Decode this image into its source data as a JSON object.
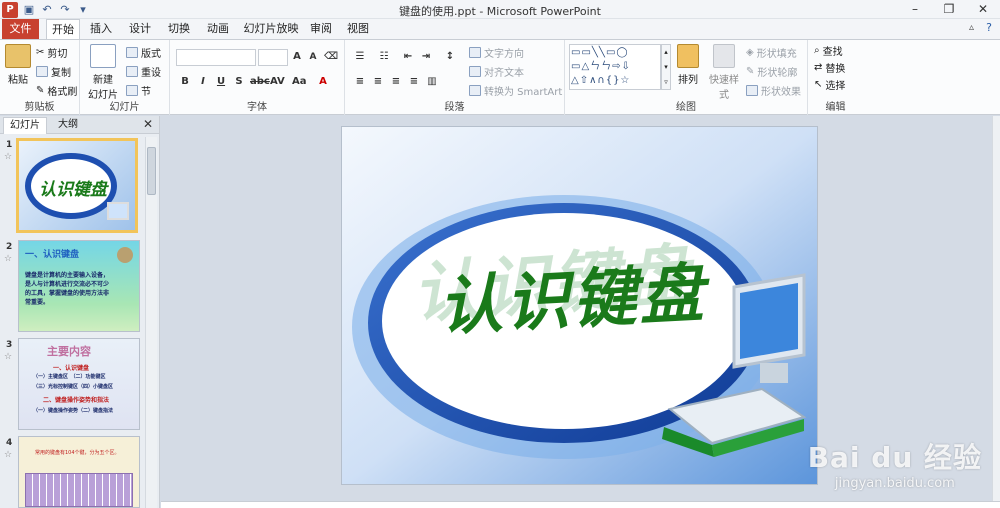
{
  "window": {
    "title": "键盘的使用.ppt - Microsoft PowerPoint"
  },
  "tabs": [
    "文件",
    "开始",
    "插入",
    "设计",
    "切换",
    "动画",
    "幻灯片放映",
    "审阅",
    "视图"
  ],
  "ribbon": {
    "clipboard": {
      "paste": "粘贴",
      "cut": "剪切",
      "copy": "复制",
      "format_painter": "格式刷",
      "label": "剪贴板"
    },
    "slides": {
      "new_slide": "新建",
      "new_slide2": "幻灯片",
      "layout": "版式",
      "reset": "重设",
      "section": "节",
      "label": "幻灯片"
    },
    "font": {
      "label": "字体"
    },
    "paragraph": {
      "text_direction": "文字方向",
      "align_text": "对齐文本",
      "smartart": "转换为 SmartArt",
      "label": "段落"
    },
    "drawing": {
      "arrange": "排列",
      "quick_styles": "快速样式",
      "shape_fill": "形状填充",
      "shape_outline": "形状轮廓",
      "shape_effects": "形状效果",
      "label": "绘图"
    },
    "editing": {
      "find": "查找",
      "replace": "替换",
      "select": "选择",
      "label": "编辑"
    }
  },
  "left_pane": {
    "tab_slides": "幻灯片",
    "tab_outline": "大纲"
  },
  "thumbnails": [
    {
      "num": "1",
      "title": "认识键盘"
    },
    {
      "num": "2",
      "title": "一、认识键盘",
      "body": "键盘是计算机的主要输入设备，是人与计算机进行交流必不可少的工具，掌握键盘的使用方法非常重要。"
    },
    {
      "num": "3",
      "title": "主要内容",
      "l1": "一、认识键盘",
      "l2": "（一）主键盘区　（二）功能键区",
      "l3": "（三）光标控制键区（四）小键盘区",
      "l4": "二、键盘操作姿势和指法",
      "l5": "（一）键盘操作姿势（二）键盘指法"
    },
    {
      "num": "4",
      "title": "常用的键盘有104个键，分为五个区。"
    }
  ],
  "slide": {
    "title": "认识键盘"
  },
  "watermark": {
    "brand": "Bai du 经验",
    "url": "jingyan.baidu.com"
  },
  "colors": {
    "file_tab": "#c8412f",
    "slide_blue": "#1e4fb0",
    "title_green": "#1a7a1a"
  }
}
